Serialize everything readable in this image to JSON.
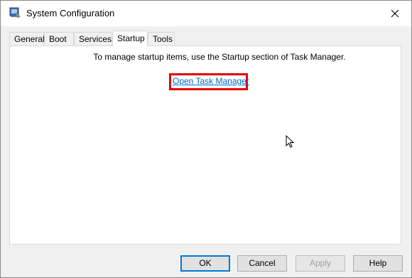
{
  "window": {
    "title": "System Configuration"
  },
  "tabs": [
    {
      "label": "General"
    },
    {
      "label": "Boot"
    },
    {
      "label": "Services"
    },
    {
      "label": "Startup"
    },
    {
      "label": "Tools"
    }
  ],
  "active_tab": "Startup",
  "startup": {
    "info_text": "To manage startup items, use the Startup section of Task Manager.",
    "link_label": "Open Task Manager"
  },
  "buttons": {
    "ok": "OK",
    "cancel": "Cancel",
    "apply": "Apply",
    "help": "Help"
  },
  "colors": {
    "link": "#0066cc",
    "highlight": "#e00000",
    "default_button_border": "#0078d7"
  },
  "icons": {
    "app": "msconfig-icon",
    "close": "close-icon",
    "cursor": "mouse-pointer-icon"
  }
}
